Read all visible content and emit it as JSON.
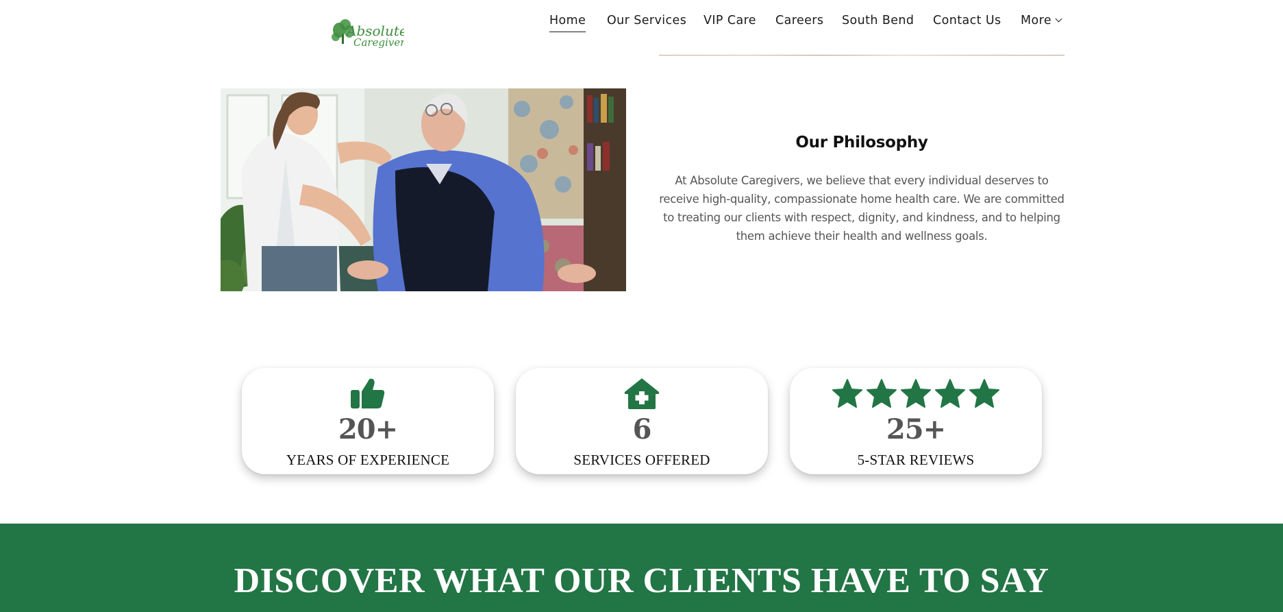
{
  "brand": {
    "logo_line1": "Absolute",
    "logo_line2": "Caregivers",
    "logo_color": "#3e8e3c"
  },
  "nav": {
    "items": [
      {
        "label": "Home",
        "active": true
      },
      {
        "label": "Our Services"
      },
      {
        "label": "VIP Care"
      },
      {
        "label": "Careers"
      },
      {
        "label": "South Bend"
      },
      {
        "label": "Contact Us"
      },
      {
        "label": "More",
        "has_dropdown": true
      }
    ]
  },
  "philosophy": {
    "title": "Our Philosophy",
    "body": "At Absolute Caregivers, we believe that every individual deserves to receive high-quality, compassionate home health care. We are committed to treating our clients with respect, dignity, and kindness, and to helping them achieve their health and wellness goals."
  },
  "stats": [
    {
      "icon": "thumbs-up-icon",
      "value": "20+",
      "label": "YEARS OF EXPERIENCE"
    },
    {
      "icon": "house-medical-icon",
      "value": "6",
      "label": "SERVICES OFFERED"
    },
    {
      "icon": "star-icon",
      "stars": 5,
      "value": "25+",
      "label": "5-STAR REVIEWS"
    }
  ],
  "banner": {
    "title": "DISCOVER WHAT OUR CLIENTS HAVE TO SAY"
  },
  "colors": {
    "accent_green": "#227545",
    "stat_value_gray": "#555555",
    "body_text_gray": "#555555"
  }
}
